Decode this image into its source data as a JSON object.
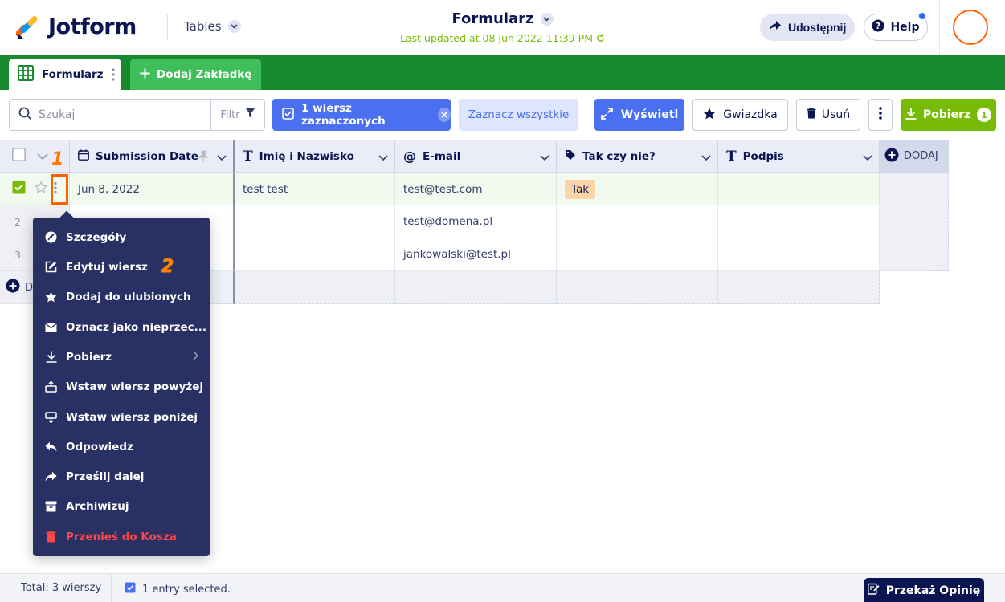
{
  "app": {
    "brand": "Jotform",
    "tables_label": "Tables",
    "title": "Formularz",
    "last_updated": "Last updated at 08 Jun 2022 11:39 PM",
    "share_label": "Udostępnij",
    "help_label": "Help"
  },
  "tabs": {
    "active_label": "Formularz",
    "add_label": "Dodaj Zakładkę"
  },
  "toolbar": {
    "search_placeholder": "Szukaj",
    "filter_label": "Filtr",
    "selected_label": "1 wiersz zaznaczonych",
    "select_all_label": "Zaznacz wszystkie",
    "view_label": "Wyświetl",
    "star_label": "Gwiazdka",
    "delete_label": "Usuń",
    "download_label": "Pobierz",
    "download_count": "1"
  },
  "columns": [
    {
      "label": "Submission Date",
      "icon": "calendar-icon"
    },
    {
      "label": "Imię i Nazwisko",
      "icon": "text-icon"
    },
    {
      "label": "E-mail",
      "icon": "at-icon"
    },
    {
      "label": "Tak czy nie?",
      "icon": "tag-icon"
    },
    {
      "label": "Podpis",
      "icon": "text-icon"
    }
  ],
  "add_column_label": "DODAJ",
  "rows": [
    {
      "num": "",
      "date": "Jun 8, 2022",
      "name": "test test",
      "email": "test@test.com",
      "yesno": "Tak",
      "sign": ""
    },
    {
      "num": "2",
      "date": "",
      "name": "",
      "email": "test@domena.pl",
      "yesno": "",
      "sign": ""
    },
    {
      "num": "3",
      "date": "",
      "name": "",
      "email": "jankowalski@test.pl",
      "yesno": "",
      "sign": ""
    }
  ],
  "add_row_label": "D",
  "footer": {
    "total": "Total: 3 wierszy",
    "entry_selected": "1 entry selected.",
    "feedback_label": "Przekaż Opinię"
  },
  "context_menu": {
    "items": [
      {
        "label": "Szczegóły",
        "icon": "details-icon"
      },
      {
        "label": "Edytuj wiersz",
        "icon": "edit-icon"
      },
      {
        "label": "Dodaj do ulubionych",
        "icon": "star-icon"
      },
      {
        "label": "Oznacz jako nieprzec...",
        "icon": "mail-icon"
      },
      {
        "label": "Pobierz",
        "icon": "download-icon"
      },
      {
        "label": "Wstaw wiersz powyżej",
        "icon": "insert-above-icon"
      },
      {
        "label": "Wstaw wiersz poniżej",
        "icon": "insert-below-icon"
      },
      {
        "label": "Odpowiedz",
        "icon": "reply-icon"
      },
      {
        "label": "Prześlij dalej",
        "icon": "forward-icon"
      },
      {
        "label": "Archiwizuj",
        "icon": "archive-icon"
      },
      {
        "label": "Przenieś do Kosza",
        "icon": "trash-icon"
      }
    ]
  },
  "annotations": {
    "step1": "1",
    "step2": "2"
  },
  "colors": {
    "brand_green": "#178a2e",
    "accent_blue": "#4a6ff0",
    "download_green": "#78bb07",
    "menu_bg": "#293064",
    "danger": "#ff4948",
    "annotation": "#ff6100"
  }
}
